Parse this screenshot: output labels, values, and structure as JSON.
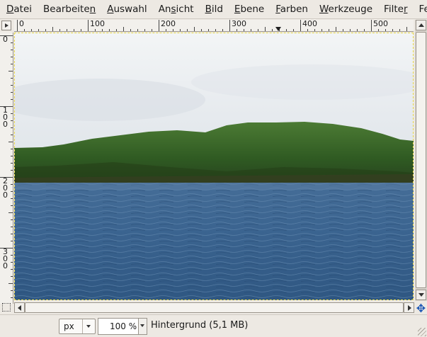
{
  "menubar": {
    "items": [
      {
        "pre": "",
        "ul": "D",
        "post": "atei"
      },
      {
        "pre": "Bearbeite",
        "ul": "n",
        "post": ""
      },
      {
        "pre": "",
        "ul": "A",
        "post": "uswahl"
      },
      {
        "pre": "An",
        "ul": "s",
        "post": "icht"
      },
      {
        "pre": "",
        "ul": "B",
        "post": "ild"
      },
      {
        "pre": "",
        "ul": "E",
        "post": "bene"
      },
      {
        "pre": "",
        "ul": "F",
        "post": "arben"
      },
      {
        "pre": "",
        "ul": "W",
        "post": "erkzeuge"
      },
      {
        "pre": "Filte",
        "ul": "r",
        "post": ""
      },
      {
        "pre": "Fenste",
        "ul": "",
        "post": ""
      }
    ]
  },
  "rulers": {
    "horizontal_labels": [
      "0",
      "100",
      "200",
      "300",
      "400",
      "500"
    ],
    "vertical_labels": [
      [
        "0"
      ],
      [
        "1",
        "0",
        "0"
      ],
      [
        "2",
        "0",
        "0"
      ],
      [
        "3",
        "0",
        "0"
      ]
    ]
  },
  "canvas": {
    "scene": "sea-and-island-photo"
  },
  "statusbar": {
    "unit": "px",
    "zoom": "100 %",
    "layer_info": "Hintergrund (5,1 MB)"
  },
  "icons": {
    "navigate": "✥"
  },
  "colors": {
    "sky": "#e9edf0",
    "island": "#3b6a2a",
    "sea": "#3a5f8a",
    "selection_border": "#e8d84a",
    "chrome": "#ede9e3"
  }
}
